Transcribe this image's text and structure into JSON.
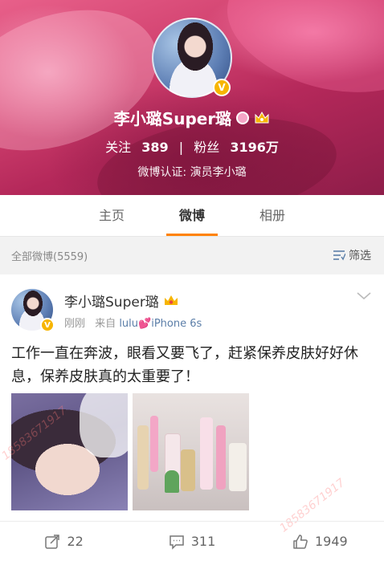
{
  "profile": {
    "name": "李小璐Super璐",
    "following_label": "关注",
    "following_count": "389",
    "divider": "|",
    "followers_label": "粉丝",
    "followers_count": "3196万",
    "verification": "微博认证: 演员李小璐",
    "verified_badge": "V"
  },
  "tabs": [
    {
      "label": "主页",
      "active": false
    },
    {
      "label": "微博",
      "active": true
    },
    {
      "label": "相册",
      "active": false
    }
  ],
  "filter": {
    "count_text": "全部微博(5559)",
    "button_label": "筛选"
  },
  "post": {
    "author": "李小璐Super璐",
    "verified_badge": "V",
    "time": "刚刚",
    "from_label": "来自",
    "source_prefix": "lulu",
    "source_suffix": "iPhone 6s",
    "text": "工作一直在奔波，眼看又要飞了，赶紧保养皮肤好好休息，保养皮肤真的太重要了！",
    "watermark": "18583671917",
    "actions": {
      "repost_count": "22",
      "comment_count": "311",
      "like_count": "1949"
    }
  },
  "colors": {
    "accent": "#ff8200",
    "verified": "#f7b500",
    "source_link": "#5b7ea8"
  }
}
